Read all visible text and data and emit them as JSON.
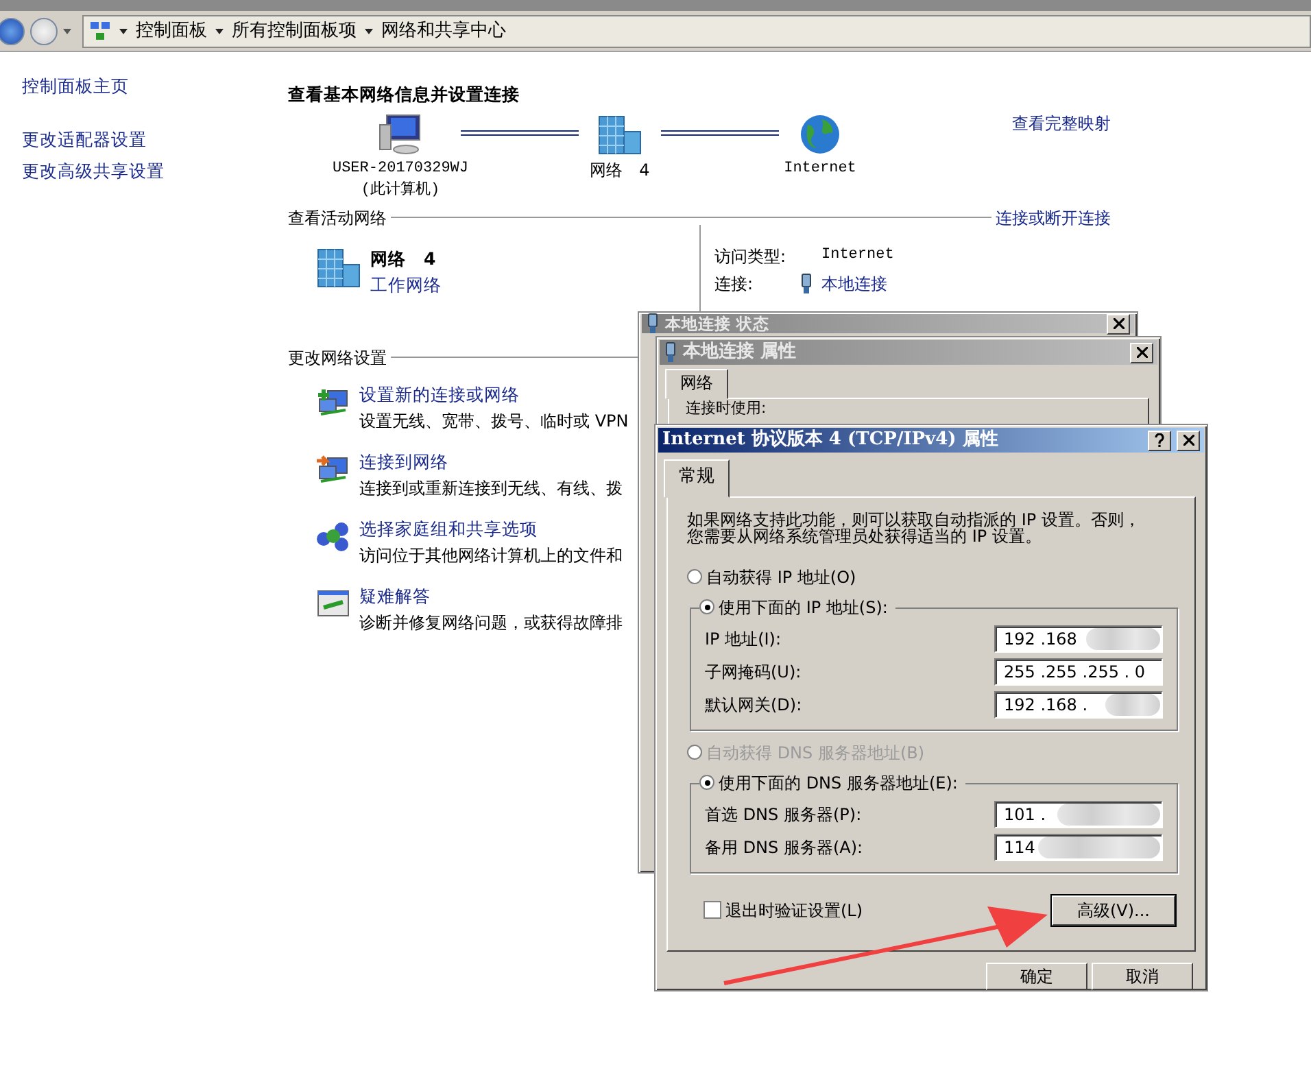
{
  "address_bar": {
    "breadcrumbs": [
      "控制面板",
      "所有控制面板项",
      "网络和共享中心"
    ]
  },
  "sidebar": {
    "links": [
      "控制面板主页",
      "更改适配器设置",
      "更改高级共享设置"
    ]
  },
  "overview": {
    "title": "查看基本网络信息并设置连接",
    "full_map_link": "查看完整映射",
    "nodes": [
      {
        "kind": "computer",
        "label": "USER-20170329WJ",
        "sublabel": "(此计算机)"
      },
      {
        "kind": "network",
        "label": "网络　4"
      },
      {
        "kind": "internet",
        "label": "Internet"
      }
    ]
  },
  "active_networks": {
    "heading": "查看活动网络",
    "connect_link": "连接或断开连接",
    "name": "网络　4",
    "type": "工作网络",
    "access_type_label": "访问类型:",
    "access_type": "Internet",
    "connections_label": "连接:",
    "connection": "本地连接"
  },
  "change_settings": {
    "heading": "更改网络设置",
    "items": [
      {
        "kind": "new-connection",
        "title": "设置新的连接或网络",
        "description": "设置无线、宽带、拨号、临时或 VPN"
      },
      {
        "kind": "connect",
        "title": "连接到网络",
        "description": "连接到或重新连接到无线、有线、拨"
      },
      {
        "kind": "homegroup",
        "title": "选择家庭组和共享选项",
        "description": "访问位于其他网络计算机上的文件和"
      },
      {
        "kind": "troubleshoot",
        "title": "疑难解答",
        "description": "诊断并修复网络问题，或获得故障排"
      }
    ]
  },
  "status_dialog": {
    "title": "本地连接 状态"
  },
  "properties_dialog": {
    "title": "本地连接 属性",
    "tabs": [
      {
        "label": "网络",
        "selected": true
      }
    ],
    "connect_using_label": "连接时使用:"
  },
  "ipv4_dialog": {
    "title": "Internet 协议版本 4 (TCP/IPv4) 属性",
    "tabs": [
      {
        "label": "常规",
        "selected": true
      }
    ],
    "description_lines": [
      "如果网络支持此功能，则可以获取自动指派的 IP 设置。否则，",
      "您需要从网络系统管理员处获得适当的 IP 设置。"
    ],
    "ip_options": [
      {
        "label": "自动获得 IP 地址(O)",
        "selected": false,
        "disabled": false
      },
      {
        "label": "使用下面的 IP 地址(S):",
        "selected": true,
        "disabled": false
      }
    ],
    "ip_fields": [
      {
        "label": "IP 地址(I):",
        "value": "192 .168",
        "redacted": true
      },
      {
        "label": "子网掩码(U):",
        "value": "255 .255 .255 . 0",
        "redacted": false
      },
      {
        "label": "默认网关(D):",
        "value": "192 .168 .",
        "redacted": true
      }
    ],
    "dns_options": [
      {
        "label": "自动获得 DNS 服务器地址(B)",
        "selected": false,
        "disabled": true
      },
      {
        "label": "使用下面的 DNS 服务器地址(E):",
        "selected": true,
        "disabled": false
      }
    ],
    "dns_fields": [
      {
        "label": "首选 DNS 服务器(P):",
        "value": "101 .",
        "redacted": true
      },
      {
        "label": "备用 DNS 服务器(A):",
        "value": "114",
        "redacted": true
      }
    ],
    "validate_on_exit": {
      "label": "退出时验证设置(L)",
      "checked": false
    },
    "advanced_button": "高级(V)...",
    "buttons": [
      "确定",
      "取消"
    ]
  }
}
